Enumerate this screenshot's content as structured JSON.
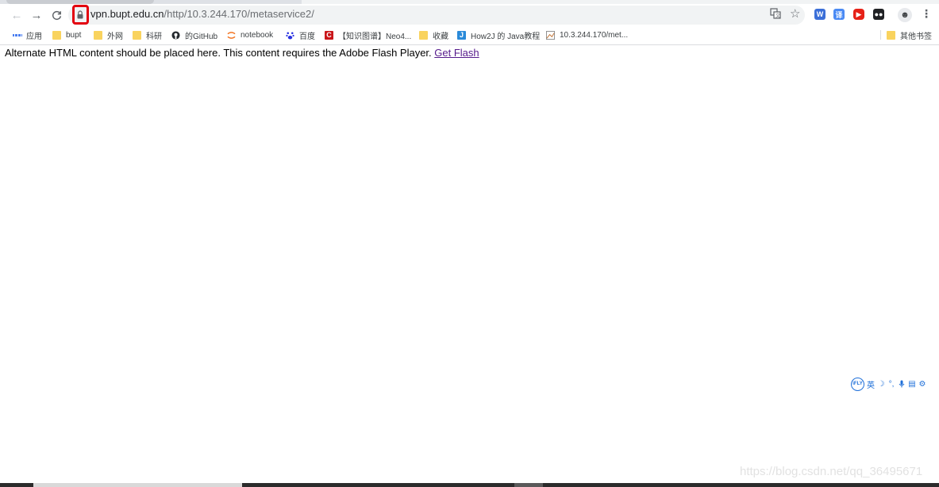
{
  "browser": {
    "url_host": "vpn.bupt.edu.cn",
    "url_path": "/http/10.3.244.170/metaservice2/",
    "nav": {
      "back_icon": "←",
      "forward_icon": "→",
      "reload_icon": "C"
    },
    "menu_icon": "⋮"
  },
  "bookmarks": [
    {
      "label": "应用",
      "icon": "apps-grid-icon"
    },
    {
      "label": "bupt",
      "icon": "folder-icon"
    },
    {
      "label": "外网",
      "icon": "folder-icon"
    },
    {
      "label": "科研",
      "icon": "folder-icon"
    },
    {
      "label": "的GitHub",
      "icon": "github-icon"
    },
    {
      "label": "notebook",
      "icon": "jupyter-icon"
    },
    {
      "label": "百度",
      "icon": "baidu-icon"
    },
    {
      "label": "【知识图谱】Neo4...",
      "icon": "csdn-icon"
    },
    {
      "label": "收藏",
      "icon": "folder-icon"
    },
    {
      "label": "How2J 的 Java教程",
      "icon": "how2j-icon"
    },
    {
      "label": "10.3.244.170/met...",
      "icon": "page-icon"
    },
    {
      "label": "其他书签",
      "icon": "folder-icon"
    }
  ],
  "content": {
    "text": "Alternate HTML content should be placed here. This content requires the Adobe Flash Player.",
    "link": "Get Flash"
  },
  "ime": {
    "logo": "iFLY",
    "lang": "英",
    "items": [
      "☽",
      "°,",
      "🎤",
      "▤",
      "⚙"
    ]
  },
  "watermark": "https://blog.csdn.net/qq_36495671",
  "colors": {
    "highlight": "#e3000f",
    "link": "#551a8b",
    "folder": "#f9d35e"
  }
}
